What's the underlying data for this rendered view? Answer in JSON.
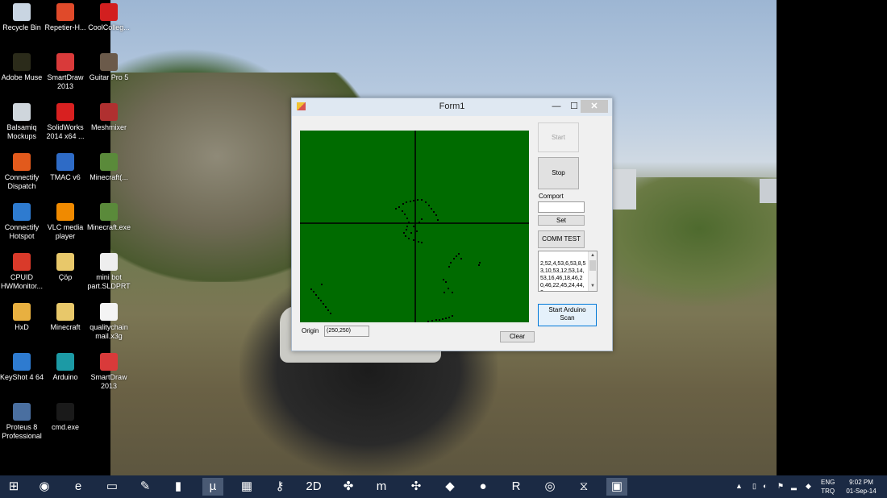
{
  "desktop": {
    "icons": [
      {
        "label": "Recycle Bin",
        "icon": "recycle-bin-icon",
        "color": "#c9d5e2"
      },
      {
        "label": "Repetier-H...",
        "icon": "repetier-icon",
        "color": "#e04a2a"
      },
      {
        "label": "CoolColleg...",
        "icon": "pdf-icon",
        "color": "#d21f1f"
      },
      {
        "label": "Adobe Muse",
        "icon": "adobe-muse-icon",
        "color": "#2b2b1a"
      },
      {
        "label": "SmartDraw 2013",
        "icon": "smartdraw-icon",
        "color": "#d93a3a"
      },
      {
        "label": "Guitar Pro 5",
        "icon": "guitar-pro-icon",
        "color": "#6b5a4a"
      },
      {
        "label": "Balsamiq Mockups",
        "icon": "balsamiq-icon",
        "color": "#cfd6dc"
      },
      {
        "label": "SolidWorks 2014 x64 ...",
        "icon": "solidworks-icon",
        "color": "#d82020"
      },
      {
        "label": "Meshmixer",
        "icon": "meshmixer-icon",
        "color": "#b03030"
      },
      {
        "label": "Connectify Dispatch",
        "icon": "connectify-dispatch-icon",
        "color": "#e25a1c"
      },
      {
        "label": "TMAC v6",
        "icon": "tmac-icon",
        "color": "#2e6bc6"
      },
      {
        "label": "Minecraft(...",
        "icon": "minecraft-icon",
        "color": "#5a8a3a"
      },
      {
        "label": "Connectify Hotspot",
        "icon": "connectify-hotspot-icon",
        "color": "#2e7bd0"
      },
      {
        "label": "VLC media player",
        "icon": "vlc-icon",
        "color": "#f08a00"
      },
      {
        "label": "Minecraft.exe",
        "icon": "minecraft-exe-icon",
        "color": "#5a8a3a"
      },
      {
        "label": "CPUID HWMonitor...",
        "icon": "cpuid-icon",
        "color": "#d93a2a"
      },
      {
        "label": "Çöp",
        "icon": "folder-icon",
        "color": "#e8c86a"
      },
      {
        "label": "mini bot part.SLDPRT",
        "icon": "sldprt-file-icon",
        "color": "#eeeeee"
      },
      {
        "label": "HxD",
        "icon": "hxd-icon",
        "color": "#e8b040"
      },
      {
        "label": "Minecraft",
        "icon": "folder-icon",
        "color": "#e8c86a"
      },
      {
        "label": "qualitychain mail.x3g",
        "icon": "file-icon",
        "color": "#f4f4f4"
      },
      {
        "label": "KeyShot 4 64",
        "icon": "keyshot-icon",
        "color": "#2e7bd0"
      },
      {
        "label": "Arduino",
        "icon": "arduino-icon",
        "color": "#1c9aa5"
      },
      {
        "label": "SmartDraw 2013",
        "icon": "smartdraw-icon",
        "color": "#d93a3a"
      },
      {
        "label": "Proteus 8 Professional",
        "icon": "proteus-icon",
        "color": "#4a6fa0"
      },
      {
        "label": "cmd.exe",
        "icon": "cmd-icon",
        "color": "#1a1a1a"
      }
    ]
  },
  "form": {
    "title": "Form1",
    "minimize_glyph": "—",
    "maximize_glyph": "☐",
    "close_glyph": "✕",
    "start_label": "Start",
    "stop_label": "Stop",
    "comport_label": "Comport",
    "comport_value": "",
    "set_label": "Set",
    "comm_test_label": "COMM TEST",
    "data_text": "2,52,4,53,6,53,8,53,10,53,12,53,14,53,16,46,18,46,20,46,22,45,24,44,2",
    "arduino_scan_label_1": "Start Arduino",
    "arduino_scan_label_2": "Scan",
    "origin_label": "Origin",
    "origin_value": "(250,250)",
    "clear_label": "Clear",
    "scan_bg_color": "#006b00",
    "scan_point_color": "#000000"
  },
  "taskbar": {
    "apps": [
      {
        "icon": "windows-start-icon",
        "glyph": "⊞"
      },
      {
        "icon": "firefox-icon",
        "glyph": "◉"
      },
      {
        "icon": "internet-explorer-icon",
        "glyph": "e"
      },
      {
        "icon": "file-explorer-icon",
        "glyph": "▭"
      },
      {
        "icon": "paint-icon",
        "glyph": "✎"
      },
      {
        "icon": "terminal-icon",
        "glyph": "▮"
      },
      {
        "icon": "utorrent-icon",
        "glyph": "µ"
      },
      {
        "icon": "calculator-icon",
        "glyph": "▦"
      },
      {
        "icon": "key-icon",
        "glyph": "⚷"
      },
      {
        "icon": "cura-2d-icon",
        "glyph": "2D"
      },
      {
        "icon": "network-icon",
        "glyph": "✤"
      },
      {
        "icon": "mu-icon",
        "glyph": "m"
      },
      {
        "icon": "robot-icon",
        "glyph": "✣"
      },
      {
        "icon": "meshmixer-icon",
        "glyph": "◆"
      },
      {
        "icon": "eclipse-icon",
        "glyph": "●"
      },
      {
        "icon": "repetier-icon",
        "glyph": "R"
      },
      {
        "icon": "chrome-icon",
        "glyph": "◎"
      },
      {
        "icon": "visual-studio-icon",
        "glyph": "⧖"
      },
      {
        "icon": "form1-app-icon",
        "glyph": "▣"
      }
    ],
    "language": "ENG",
    "keyboard": "TRQ",
    "time": "9:02 PM",
    "date": "01-Sep-14"
  }
}
